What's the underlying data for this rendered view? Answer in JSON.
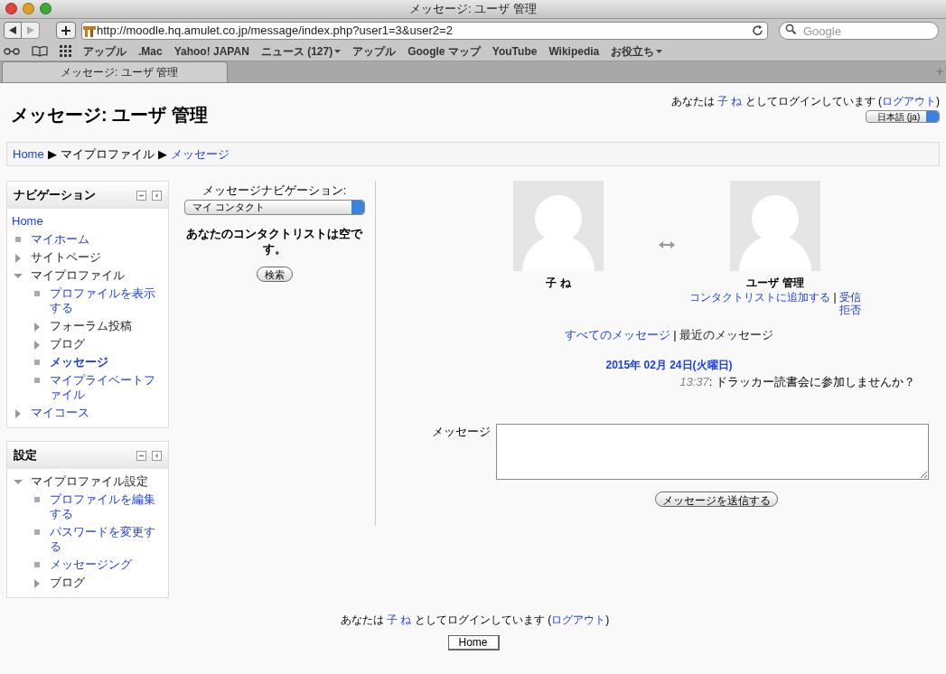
{
  "window": {
    "title": "メッセージ: ユーザ 管理"
  },
  "toolbar": {
    "url": "http://moodle.hq.amulet.co.jp/message/index.php?user1=3&user2=2",
    "search": {
      "placeholder": "Google"
    }
  },
  "bookmarks": [
    {
      "label": "アップル",
      "menu": false
    },
    {
      "label": ".Mac",
      "menu": false
    },
    {
      "label": "Yahoo! JAPAN",
      "menu": false
    },
    {
      "label": "ニュース (127)",
      "menu": true
    },
    {
      "label": "アップル",
      "menu": false
    },
    {
      "label": "Google マップ",
      "menu": false
    },
    {
      "label": "YouTube",
      "menu": false
    },
    {
      "label": "Wikipedia",
      "menu": false
    },
    {
      "label": "お役立ち",
      "menu": true
    }
  ],
  "tabs": [
    {
      "label": "メッセージ: ユーザ 管理",
      "selected": true
    }
  ],
  "page": {
    "heading": "メッセージ: ユーザ 管理",
    "login_header": {
      "prefix": "あなたは",
      "user": "子 ね",
      "middle": "としてログインしています (",
      "logout": "ログアウト",
      "suffix": ")"
    },
    "language": "日本語 (ja)",
    "breadcrumb": {
      "separator": "▶",
      "items": [
        {
          "label": "Home",
          "kind": "link"
        },
        {
          "label": "マイプロファイル",
          "kind": "text"
        },
        {
          "label": "メッセージ",
          "kind": "link"
        }
      ]
    },
    "blocks": [
      {
        "title": "ナビゲーション",
        "root": "Home",
        "items": [
          {
            "label": "マイホーム",
            "kind": "leaf",
            "link": true,
            "selected": false
          },
          {
            "label": "サイトページ",
            "kind": "branch",
            "link": false,
            "expanded": false,
            "selected": false
          },
          {
            "label": "マイプロファイル",
            "kind": "branch",
            "link": false,
            "expanded": true,
            "selected": false,
            "children": [
              {
                "label": "プロファイルを表示する",
                "kind": "leaf",
                "link": true,
                "selected": false
              },
              {
                "label": "フォーラム投稿",
                "kind": "branch",
                "link": false,
                "expanded": false,
                "selected": false
              },
              {
                "label": "ブログ",
                "kind": "branch",
                "link": false,
                "expanded": false,
                "selected": false
              },
              {
                "label": "メッセージ",
                "kind": "leaf",
                "link": true,
                "selected": true
              },
              {
                "label": "マイプライベートファイル",
                "kind": "leaf",
                "link": true,
                "selected": false
              }
            ]
          },
          {
            "label": "マイコース",
            "kind": "branch",
            "link": true,
            "expanded": false,
            "selected": false
          }
        ]
      },
      {
        "title": "設定",
        "items": [
          {
            "label": "マイプロファイル設定",
            "kind": "branch",
            "link": false,
            "expanded": true,
            "selected": false,
            "children": [
              {
                "label": "プロファイルを編集する",
                "kind": "leaf",
                "link": true,
                "selected": false
              },
              {
                "label": "パスワードを変更する",
                "kind": "leaf",
                "link": true,
                "selected": false
              },
              {
                "label": "メッセージング",
                "kind": "leaf",
                "link": true,
                "selected": false
              },
              {
                "label": "ブログ",
                "kind": "branch",
                "link": false,
                "expanded": false,
                "selected": false
              }
            ]
          }
        ]
      }
    ],
    "message_nav": {
      "label": "メッセージナビゲーション:",
      "select": "マイ コンタクト",
      "empty_text": "あなたのコンタクトリストは空です。",
      "search_button": "検索"
    },
    "conversation": {
      "users": [
        {
          "name": "子 ね"
        },
        {
          "name": "ユーザ 管理",
          "actions": [
            {
              "label": "コンタクトリストに追加する"
            },
            {
              "label": "受信拒否"
            }
          ]
        }
      ],
      "separator": "|",
      "views": [
        {
          "label": "すべてのメッセージ",
          "selected": false
        },
        {
          "label": "最近のメッセージ",
          "selected": true
        }
      ],
      "date": "2015年 02月 24日(火曜日)",
      "messages": [
        {
          "time": "13:37",
          "text": ": ドラッカー読書会に参加しませんか？"
        }
      ],
      "form": {
        "label": "メッセージ",
        "send_button": "メッセージを送信する"
      }
    },
    "footer": {
      "login": {
        "prefix": "あなたは",
        "user": "子 ね",
        "middle": "としてログインしています (",
        "logout": "ログアウト",
        "suffix": ")"
      },
      "home_button": "Home"
    }
  }
}
